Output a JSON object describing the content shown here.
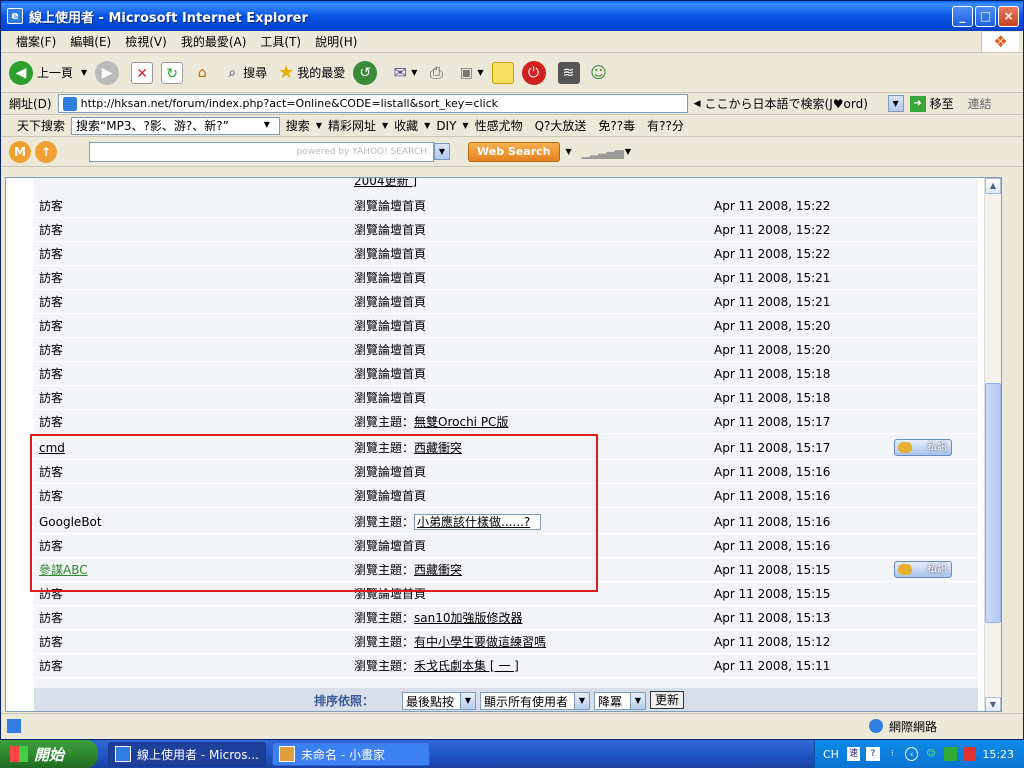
{
  "window": {
    "title": "線上使用者 - Microsoft Internet Explorer",
    "minimize": "_",
    "maximize": "□",
    "close": "×"
  },
  "menu": [
    "檔案(F)",
    "編輯(E)",
    "檢視(V)",
    "我的最愛(A)",
    "工具(T)",
    "說明(H)"
  ],
  "toolbar": {
    "back_label": "上一頁",
    "search_label": "搜尋",
    "favorites_label": "我的最愛"
  },
  "address": {
    "label": "網址(D)",
    "url": "http://hksan.net/forum/index.php?act=Online&CODE=listall&sort_key=click",
    "jp_search": "ここから日本語で検索(J♥ord)",
    "go_label": "移至",
    "links_label": "連結"
  },
  "linkbar": {
    "items": [
      "天下搜索",
      "搜索“MP3、?影、游?、新?”",
      "搜索",
      "精彩网址",
      "收藏",
      "DIY",
      "性感尤物",
      "Q?大放送",
      "免??毒",
      "有??分"
    ]
  },
  "yahoobar": {
    "search_placeholder": "powered by YAHOO! SEARCH",
    "web_search": "Web Search"
  },
  "top_partial": "2004更新 ]",
  "rows": [
    {
      "user": "訪客",
      "action_prefix": "瀏覽論壇首頁",
      "topic": "",
      "time": "Apr 11 2008, 15:22"
    },
    {
      "user": "訪客",
      "action_prefix": "瀏覽論壇首頁",
      "topic": "",
      "time": "Apr 11 2008, 15:22"
    },
    {
      "user": "訪客",
      "action_prefix": "瀏覽論壇首頁",
      "topic": "",
      "time": "Apr 11 2008, 15:22"
    },
    {
      "user": "訪客",
      "action_prefix": "瀏覽論壇首頁",
      "topic": "",
      "time": "Apr 11 2008, 15:21"
    },
    {
      "user": "訪客",
      "action_prefix": "瀏覽論壇首頁",
      "topic": "",
      "time": "Apr 11 2008, 15:21"
    },
    {
      "user": "訪客",
      "action_prefix": "瀏覽論壇首頁",
      "topic": "",
      "time": "Apr 11 2008, 15:20"
    },
    {
      "user": "訪客",
      "action_prefix": "瀏覽論壇首頁",
      "topic": "",
      "time": "Apr 11 2008, 15:20"
    },
    {
      "user": "訪客",
      "action_prefix": "瀏覽論壇首頁",
      "topic": "",
      "time": "Apr 11 2008, 15:18"
    },
    {
      "user": "訪客",
      "action_prefix": "瀏覽論壇首頁",
      "topic": "",
      "time": "Apr 11 2008, 15:18"
    },
    {
      "user": "訪客",
      "action_prefix": "瀏覽主題：",
      "topic": "無雙Orochi PC版",
      "time": "Apr 11 2008, 15:17"
    },
    {
      "user": "cmd",
      "action_prefix": "瀏覽主題：",
      "topic": "西藏衝突",
      "time": "Apr 11 2008, 15:17",
      "pm": "私訊",
      "user_style": "link"
    },
    {
      "user": "訪客",
      "action_prefix": "瀏覽論壇首頁",
      "topic": "",
      "time": "Apr 11 2008, 15:16"
    },
    {
      "user": "訪客",
      "action_prefix": "瀏覽論壇首頁",
      "topic": "",
      "time": "Apr 11 2008, 15:16"
    },
    {
      "user": "GoogleBot",
      "action_prefix": "瀏覽主題：",
      "topic": "小弟應該什樣做......?",
      "time": "Apr 11 2008, 15:16",
      "boxed": true
    },
    {
      "user": "訪客",
      "action_prefix": "瀏覽論壇首頁",
      "topic": "",
      "time": "Apr 11 2008, 15:16"
    },
    {
      "user": "參謀ABC",
      "action_prefix": "瀏覽主題：",
      "topic": "西藏衝突",
      "time": "Apr 11 2008, 15:15",
      "pm": "私訊",
      "user_style": "green"
    },
    {
      "user": "訪客",
      "action_prefix": "瀏覽論壇首頁",
      "topic": "",
      "time": "Apr 11 2008, 15:15"
    },
    {
      "user": "訪客",
      "action_prefix": "瀏覽主題：",
      "topic": "san10加強版修改器",
      "time": "Apr 11 2008, 15:13"
    },
    {
      "user": "訪客",
      "action_prefix": "瀏覽主題：",
      "topic": "有中小學生要做這練習嗎",
      "time": "Apr 11 2008, 15:12"
    },
    {
      "user": "訪客",
      "action_prefix": "瀏覽主題：",
      "topic": "禾戈氏劇本集 [ 一 ]",
      "time": "Apr 11 2008, 15:11"
    }
  ],
  "sortbar": {
    "label": "排序依照：",
    "sort_key": "最後點按",
    "filter": "顯示所有使用者",
    "order": "降冪",
    "submit": "更新"
  },
  "status": {
    "zone": "網際網路"
  },
  "taskbar": {
    "start": "開始",
    "tasks": [
      "線上使用者 - Micros...",
      "未命名 - 小畫家"
    ],
    "lang": "CH",
    "ime": "速",
    "clock": "15:23"
  }
}
